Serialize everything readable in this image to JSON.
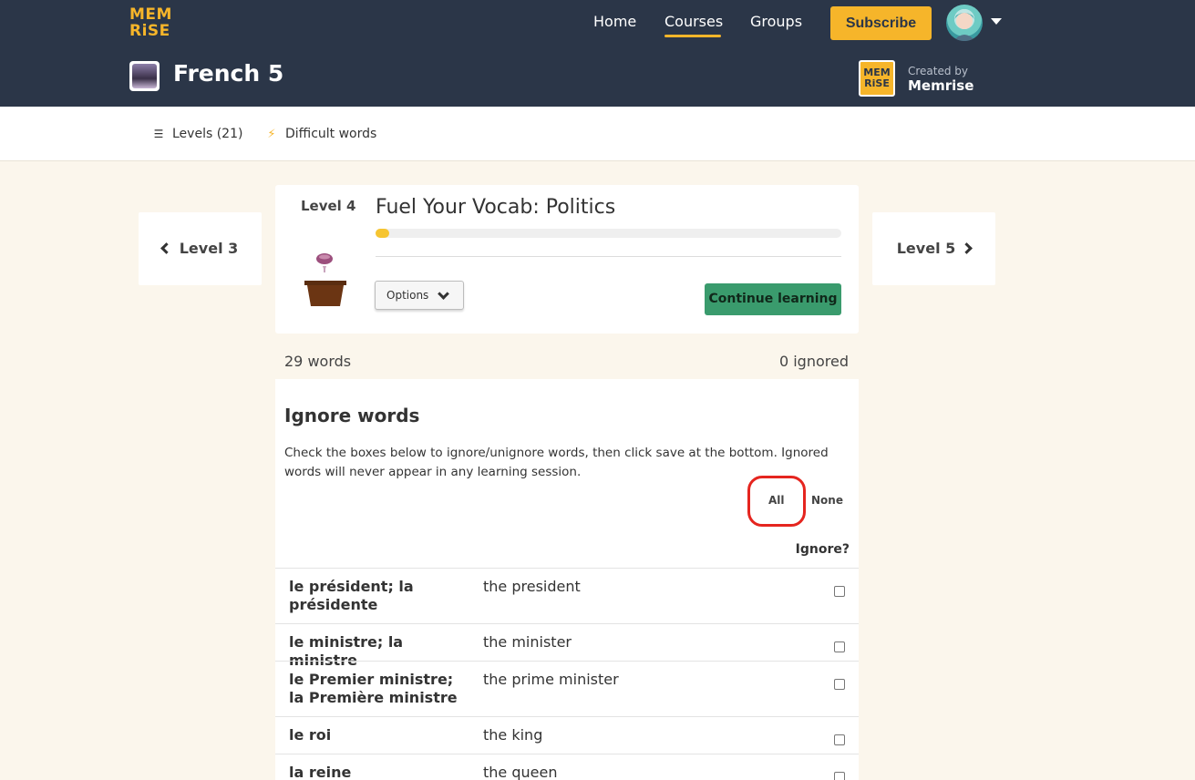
{
  "header": {
    "logo_top": "MEM",
    "logo_bottom": "RiSE",
    "nav": {
      "home": "Home",
      "courses": "Courses",
      "groups": "Groups"
    },
    "subscribe": "Subscribe",
    "course_title": "French 5",
    "created_by_label": "Created by",
    "creator_name": "Memrise",
    "creator_logo_top": "MEM",
    "creator_logo_bottom": "RiSE"
  },
  "subnav": {
    "levels": "Levels (21)",
    "difficult": "Difficult words"
  },
  "level_nav": {
    "prev": "Level 3",
    "next": "Level 5"
  },
  "level": {
    "number": "Level 4",
    "title": "Fuel Your Vocab: Politics",
    "progress_fraction": 0.03,
    "options": "Options",
    "continue": "Continue learning"
  },
  "counts": {
    "words": "29 words",
    "ignored": "0 ignored"
  },
  "ignore": {
    "heading": "Ignore words",
    "description": "Check the boxes below to ignore/unignore words, then click save at the bottom. Ignored words will never appear in any learning session.",
    "all": "All",
    "none": "None",
    "column": "Ignore?"
  },
  "words": [
    {
      "fr": "le président; la présidente",
      "en": "the president"
    },
    {
      "fr": "le ministre; la ministre",
      "en": "the minister"
    },
    {
      "fr": "le Premier ministre; la Première ministre",
      "en": "the prime minister"
    },
    {
      "fr": "le roi",
      "en": "the king"
    },
    {
      "fr": "la reine",
      "en": "the queen"
    }
  ],
  "colors": {
    "header_bg": "#2b3648",
    "accent": "#f6b52a",
    "continue_bg": "#3a9b6d",
    "highlight": "#e5251f",
    "page_bg": "#fbf6ec"
  }
}
